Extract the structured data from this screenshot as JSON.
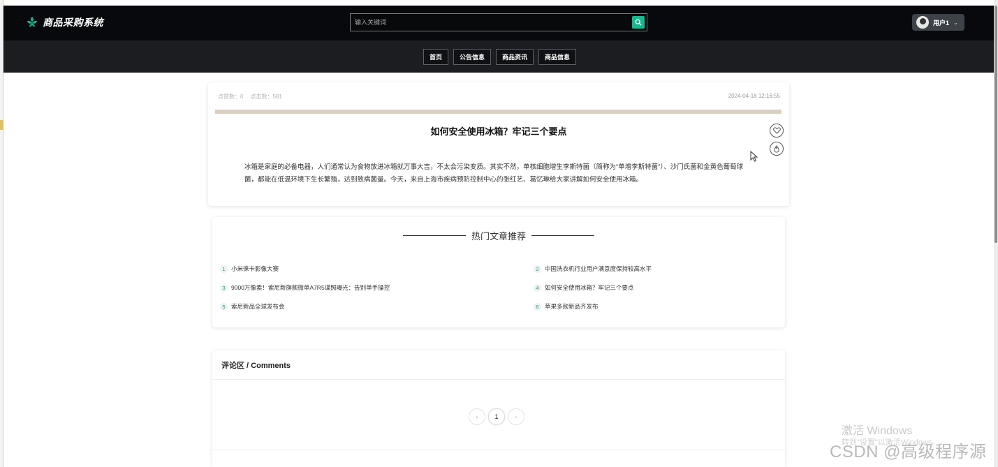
{
  "header": {
    "app_title": "商品采购系统",
    "search_placeholder": "输入关键词",
    "user_name": "用户1",
    "caret": "⌄"
  },
  "nav": {
    "items": [
      "首页",
      "公告信息",
      "商品资讯",
      "商品信息"
    ]
  },
  "article": {
    "likes_label": "点赞数：0",
    "clicks_label": "点击数：581",
    "date": "2024-04-18 12:16:55",
    "title": "如何安全使用冰箱？牢记三个要点",
    "body": "冰箱是家庭的必备电器，人们通常认为食物放进冰箱就万事大吉，不太会污染变质。其实不然，单核细胞增生李斯特菌（简称为“单增李斯特菌”）、沙门氏菌和金黄色葡萄球菌，都能在低温环境下生长繁殖，达到致病菌量。今天，来自上海市疾病预防控制中心的张红艺、葛忆琳给大家讲解如何安全使用冰箱。"
  },
  "hot": {
    "title": "热门文章推荐",
    "items": [
      {
        "num": "1",
        "label": "小米徕卡影像大赛"
      },
      {
        "num": "2",
        "label": "中国洗衣机行业用户满意度保持较高水平"
      },
      {
        "num": "3",
        "label": "9000万像素！索尼新旗舰微单A7R5谍照曝光：告别单手操控"
      },
      {
        "num": "4",
        "label": "如何安全使用冰箱？牢记三个要点"
      },
      {
        "num": "5",
        "label": "索尼新品全球发布会"
      },
      {
        "num": "6",
        "label": "苹果多款新品齐发布"
      }
    ]
  },
  "comments": {
    "title": "评论区 / Comments",
    "prev": "‹",
    "page": "1",
    "next": "›"
  },
  "overlay": {
    "windows_activate": "激活 Windows",
    "windows_sub": "转到\"设置\"以激活Windows。",
    "csdn": "CSDN @高级程序源"
  },
  "colors": {
    "accent": "#17b890",
    "topbar": "#07090c",
    "navbar": "#1b1d21",
    "divider_bar": "#d8cfc0"
  }
}
